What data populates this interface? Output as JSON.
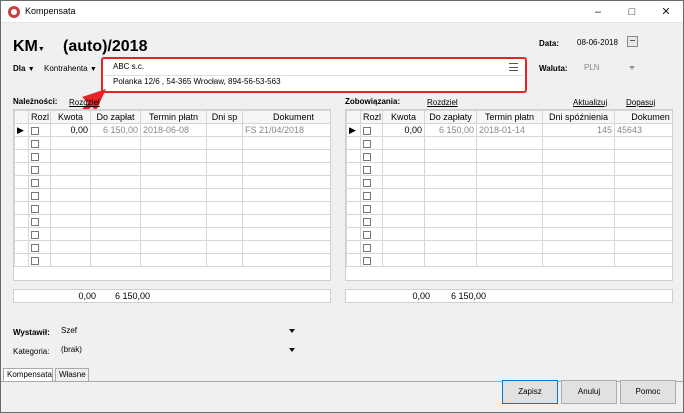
{
  "window": {
    "title": "Kompensata"
  },
  "header": {
    "doc_type": "KM",
    "doc_number": "(auto)/2018",
    "date_label": "Data:",
    "date_value": "08-06-2018"
  },
  "dla": {
    "label": "Dla",
    "value": "Kontrahenta"
  },
  "contractor": {
    "name": "ABC s.c.",
    "address": "Polanka  12/6 , 54-365 Wrocław, 894-56-53-563"
  },
  "currency": {
    "label": "Waluta:",
    "value": "PLN"
  },
  "receivables": {
    "label": "Należności:",
    "link": "Rozdziel",
    "columns": [
      "Rozl",
      "Kwota",
      "Do zapłat",
      "Termin płatn",
      "Dni sp",
      "Dokument"
    ],
    "rows": [
      {
        "kwota": "0,00",
        "do_zaplaty": "6 150,00",
        "termin": "2018-06-08",
        "dni": "",
        "dokument": "FS 21/04/2018"
      }
    ],
    "sum_kwota": "0,00",
    "sum_do_zaplaty": "6 150,00"
  },
  "liabilities": {
    "label": "Zobowiązania:",
    "link": "Rozdziel",
    "link_update": "Aktualizuj",
    "link_add": "Dopasuj",
    "columns": [
      "Rozl",
      "Kwota",
      "Do zapłaty",
      "Termin płatn",
      "Dni spóźnienia",
      "Dokumen"
    ],
    "rows": [
      {
        "kwota": "0,00",
        "do_zaplaty": "6 150,00",
        "termin": "2018-01-14",
        "dni": "145",
        "dokument": "45643"
      }
    ],
    "sum_kwota": "0,00",
    "sum_do_zaplaty": "6 150,00"
  },
  "issued_by": {
    "label": "Wystawił:",
    "value": "Szef"
  },
  "category": {
    "label": "Kategoria:",
    "value": "(brak)"
  },
  "tabs": [
    "Kompensata",
    "Własne"
  ],
  "buttons": {
    "save": "Zapisz",
    "cancel": "Anuluj",
    "help": "Pomoc"
  },
  "colors": {
    "highlight": "#e42527"
  }
}
